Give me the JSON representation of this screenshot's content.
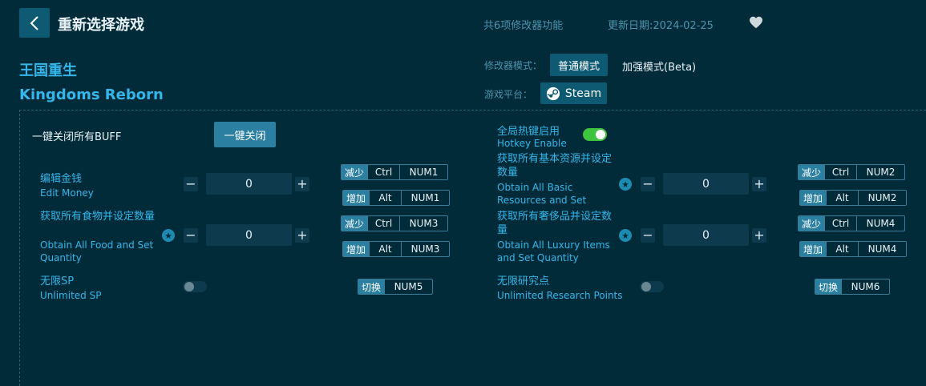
{
  "header": {
    "back_icon": "chevron-left-icon",
    "title": "重新选择游戏",
    "feature_count": "共6项修改器功能",
    "update_date": "更新日期:2024-02-25",
    "favorite_icon": "heart-icon"
  },
  "game": {
    "name_cn": "王国重生",
    "name_en": "Kingdoms Reborn"
  },
  "mode": {
    "label": "修改器模式：",
    "normal": "普通模式",
    "beta": "加强模式(Beta)"
  },
  "platform": {
    "label": "游戏平台：",
    "steam": "Steam",
    "steam_icon": "steam-icon"
  },
  "controls": {
    "onekey_label": "一键关闭所有BUFF",
    "onekey_button": "一键关闭",
    "hotkey_cn": "全局热键启用",
    "hotkey_en": "Hotkey Enable",
    "hotkey_enabled": true
  },
  "options": [
    {
      "cn": "编辑金钱",
      "en": "Edit Money",
      "value": "0",
      "starred": false,
      "dec": {
        "tag": "减少",
        "mod": "Ctrl",
        "key": "NUM1"
      },
      "inc": {
        "tag": "增加",
        "mod": "Alt",
        "key": "NUM1"
      }
    },
    {
      "cn": "获取所有基本资源并设定数量",
      "en": "Obtain All Basic Resources and Set Quantity",
      "value": "0",
      "starred": true,
      "dec": {
        "tag": "减少",
        "mod": "Ctrl",
        "key": "NUM2"
      },
      "inc": {
        "tag": "增加",
        "mod": "Alt",
        "key": "NUM2"
      }
    },
    {
      "cn": "获取所有食物并设定数量",
      "en": "Obtain All Food and Set Quantity",
      "value": "0",
      "starred": true,
      "dec": {
        "tag": "减少",
        "mod": "Ctrl",
        "key": "NUM3"
      },
      "inc": {
        "tag": "增加",
        "mod": "Alt",
        "key": "NUM3"
      }
    },
    {
      "cn": "获取所有奢侈品并设定数量",
      "en": "Obtain All Luxury Items and Set Quantity",
      "value": "0",
      "starred": true,
      "dec": {
        "tag": "减少",
        "mod": "Ctrl",
        "key": "NUM4"
      },
      "inc": {
        "tag": "增加",
        "mod": "Alt",
        "key": "NUM4"
      }
    },
    {
      "cn": "无限SP",
      "en": "Unlimited SP",
      "enabled": false,
      "toggle": {
        "tag": "切换",
        "key": "NUM5"
      }
    },
    {
      "cn": "无限研究点",
      "en": "Unlimited Research Points",
      "enabled": false,
      "toggle": {
        "tag": "切换",
        "key": "NUM6"
      }
    }
  ],
  "icons": {
    "minus": "−",
    "plus": "+",
    "star": "★"
  },
  "colors": {
    "background": "#022b3a",
    "accent": "#36b6e8",
    "button": "#0e5a73",
    "toggle_on": "#3ec43e"
  }
}
